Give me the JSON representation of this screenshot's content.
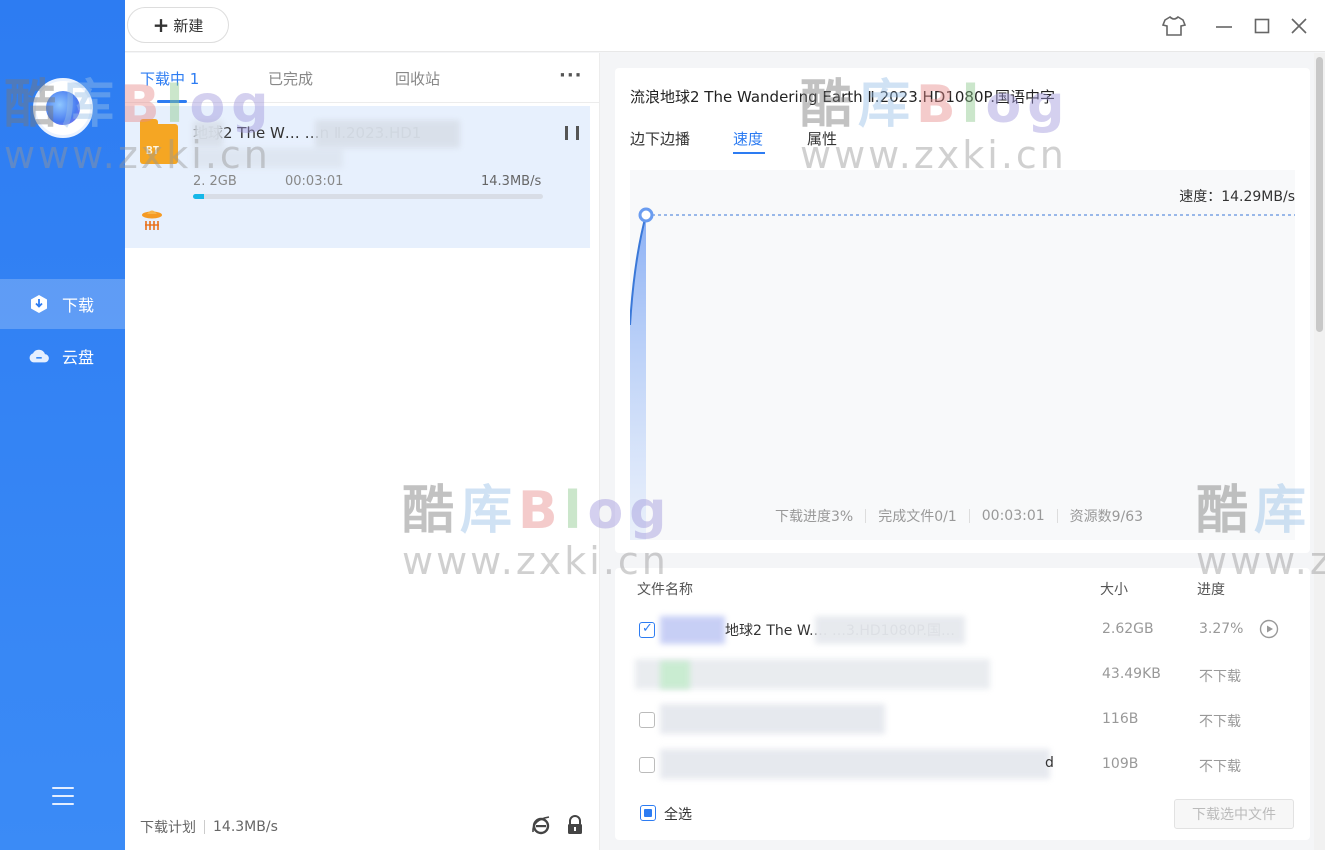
{
  "topbar": {
    "new_label": "新建"
  },
  "sidebar": {
    "items": [
      {
        "label": "下载",
        "active": true
      },
      {
        "label": "云盘",
        "active": false
      }
    ]
  },
  "list": {
    "tabs": [
      {
        "label": "下载中",
        "count": "1",
        "active": true
      },
      {
        "label": "已完成"
      },
      {
        "label": "回收站"
      }
    ],
    "more": "···",
    "task": {
      "icon_text": "BT",
      "title": "地球2 The W… …n Ⅱ.2023.HD1",
      "size": "2.  2GB",
      "time": "00:03:01",
      "speed": "14.3MB/s",
      "progress_fraction": 0.03
    },
    "footer": {
      "plan_label": "下载计划",
      "speed": "14.3MB/s"
    }
  },
  "detail": {
    "title": "流浪地球2 The Wandering Earth Ⅱ.2023.HD1080P.国语中字",
    "tabs": [
      "边下边播",
      "速度",
      "属性"
    ],
    "active_tab": 1,
    "speed_label": "速度：14.29MB/s",
    "stats": [
      "下载进度3%",
      "完成文件0/1",
      "00:03:01",
      "资源数9/63"
    ]
  },
  "files": {
    "headers": {
      "name": "文件名称",
      "size": "大小",
      "progress": "进度"
    },
    "rows": [
      {
        "name": "地球2 The W.… …3.HD1080P.国…",
        "size": "2.62GB",
        "progress": "3.27%",
        "checked": true
      },
      {
        "name": "",
        "size": "43.49KB",
        "progress": "不下载",
        "checked": false
      },
      {
        "name": "",
        "size": "116B",
        "progress": "不下载",
        "checked": false
      },
      {
        "name": "d",
        "size": "109B",
        "progress": "不下载",
        "checked": false
      }
    ],
    "select_all_label": "全选",
    "download_selected_label": "下载选中文件"
  },
  "watermark": {
    "cn_parts": [
      "酷",
      "库",
      "B",
      "l",
      "og"
    ],
    "url": "www.zxki.cn"
  },
  "colors": {
    "accent": "#2d7cf2",
    "sidebar": "#2d7cf2",
    "progress": "#15b7e8",
    "bt": "#f5a623"
  }
}
